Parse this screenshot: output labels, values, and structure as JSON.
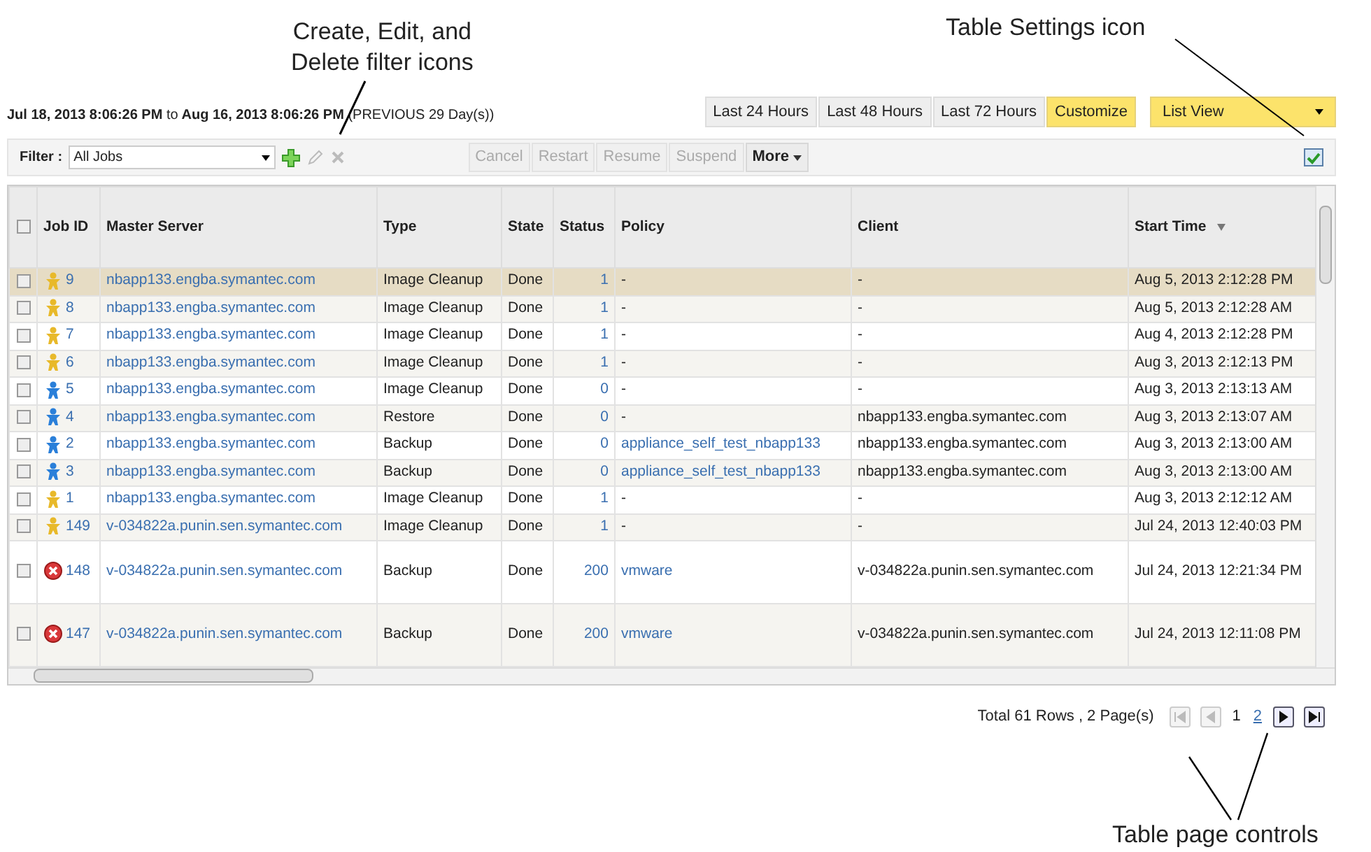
{
  "callouts": [
    {
      "kind": "filter",
      "text": "Create, Edit, and\nDelete filter icons"
    },
    {
      "kind": "settings",
      "text": "Table Settings icon"
    },
    {
      "kind": "pager",
      "text": "Table page controls"
    }
  ],
  "date_range": {
    "from": "Jul 18, 2013 8:06:26 PM",
    "to_word": "to",
    "to": "Aug 16, 2013 8:06:26 PM",
    "note": "(PREVIOUS 29 Day(s))"
  },
  "time_ranges": [
    {
      "label": "Last 24 Hours",
      "selected": false
    },
    {
      "label": "Last 48 Hours",
      "selected": false
    },
    {
      "label": "Last 72 Hours",
      "selected": false
    },
    {
      "label": "Customize",
      "selected": true
    }
  ],
  "view_select": {
    "value": "List View"
  },
  "filter": {
    "label": "Filter :",
    "value": "All Jobs"
  },
  "actions": [
    {
      "label": "Cancel",
      "disabled": true
    },
    {
      "label": "Restart",
      "disabled": true
    },
    {
      "label": "Resume",
      "disabled": true
    },
    {
      "label": "Suspend",
      "disabled": true
    },
    {
      "label": "More",
      "disabled": false
    }
  ],
  "table": {
    "all_checked": false,
    "columns": [
      "Job ID",
      "Master Server",
      "Type",
      "State",
      "Status",
      "Policy",
      "Client",
      "Start Time"
    ],
    "rows": [
      {
        "kind": "gold",
        "selected": true,
        "checked": false,
        "tall": false,
        "cells": [
          "9",
          "nbapp133.engba.symantec.com",
          "Image Cleanup",
          "Done",
          "1",
          "-",
          "-",
          "Aug 5, 2013 2:12:28 PM"
        ]
      },
      {
        "kind": "gold",
        "selected": false,
        "checked": false,
        "tall": false,
        "cells": [
          "8",
          "nbapp133.engba.symantec.com",
          "Image Cleanup",
          "Done",
          "1",
          "-",
          "-",
          "Aug 5, 2013 2:12:28 AM"
        ]
      },
      {
        "kind": "gold",
        "selected": false,
        "checked": false,
        "tall": false,
        "cells": [
          "7",
          "nbapp133.engba.symantec.com",
          "Image Cleanup",
          "Done",
          "1",
          "-",
          "-",
          "Aug 4, 2013 2:12:28 PM"
        ]
      },
      {
        "kind": "gold",
        "selected": false,
        "checked": false,
        "tall": false,
        "cells": [
          "6",
          "nbapp133.engba.symantec.com",
          "Image Cleanup",
          "Done",
          "1",
          "-",
          "-",
          "Aug 3, 2013 2:12:13 PM"
        ]
      },
      {
        "kind": "blue",
        "selected": false,
        "checked": false,
        "tall": false,
        "cells": [
          "5",
          "nbapp133.engba.symantec.com",
          "Image Cleanup",
          "Done",
          "0",
          "-",
          "-",
          "Aug 3, 2013 2:13:13 AM"
        ]
      },
      {
        "kind": "blue",
        "selected": false,
        "checked": false,
        "tall": false,
        "cells": [
          "4",
          "nbapp133.engba.symantec.com",
          "Restore",
          "Done",
          "0",
          "-",
          "nbapp133.engba.symantec.com",
          "Aug 3, 2013 2:13:07 AM"
        ]
      },
      {
        "kind": "blue",
        "selected": false,
        "checked": false,
        "tall": false,
        "cells": [
          "2",
          "nbapp133.engba.symantec.com",
          "Backup",
          "Done",
          "0",
          "appliance_self_test_nbapp133",
          "nbapp133.engba.symantec.com",
          "Aug 3, 2013 2:13:00 AM"
        ]
      },
      {
        "kind": "blue",
        "selected": false,
        "checked": false,
        "tall": false,
        "cells": [
          "3",
          "nbapp133.engba.symantec.com",
          "Backup",
          "Done",
          "0",
          "appliance_self_test_nbapp133",
          "nbapp133.engba.symantec.com",
          "Aug 3, 2013 2:13:00 AM"
        ]
      },
      {
        "kind": "gold",
        "selected": false,
        "checked": false,
        "tall": false,
        "cells": [
          "1",
          "nbapp133.engba.symantec.com",
          "Image Cleanup",
          "Done",
          "1",
          "-",
          "-",
          "Aug 3, 2013 2:12:12 AM"
        ]
      },
      {
        "kind": "gold",
        "selected": false,
        "checked": false,
        "tall": false,
        "cells": [
          "149",
          "v-034822a.punin.sen.symantec.com",
          "Image Cleanup",
          "Done",
          "1",
          "-",
          "-",
          "Jul 24, 2013 12:40:03 PM"
        ]
      },
      {
        "kind": "error",
        "selected": false,
        "checked": false,
        "tall": true,
        "cells": [
          "148",
          "v-034822a.punin.sen.symantec.com",
          "Backup",
          "Done",
          "200",
          "vmware",
          "v-034822a.punin.sen.symantec.com",
          "Jul 24, 2013 12:21:34 PM"
        ]
      },
      {
        "kind": "error",
        "selected": false,
        "checked": false,
        "tall": true,
        "cells": [
          "147",
          "v-034822a.punin.sen.symantec.com",
          "Backup",
          "Done",
          "200",
          "vmware",
          "v-034822a.punin.sen.symantec.com",
          "Jul 24, 2013 12:11:08 PM"
        ]
      }
    ]
  },
  "pagination": {
    "summary": "Total 61 Rows , 2 Page(s)",
    "pages": [
      {
        "label": "1",
        "selected": true
      },
      {
        "label": "2",
        "selected": false
      }
    ],
    "first_disabled": true,
    "prev_disabled": true,
    "next_disabled": false,
    "last_disabled": false
  }
}
